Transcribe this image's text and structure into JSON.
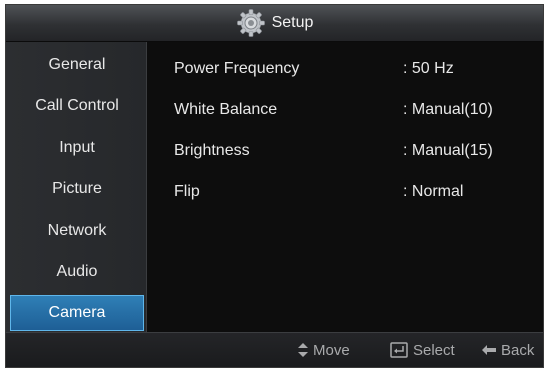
{
  "header": {
    "title": "Setup",
    "icon": "gear-icon"
  },
  "sidebar": {
    "items": [
      {
        "label": "General"
      },
      {
        "label": "Call Control"
      },
      {
        "label": "Input"
      },
      {
        "label": "Picture"
      },
      {
        "label": "Network"
      },
      {
        "label": "Audio"
      },
      {
        "label": "Camera",
        "selected": true
      }
    ]
  },
  "settings": [
    {
      "label": "Power Frequency",
      "value": ": 50 Hz"
    },
    {
      "label": "White Balance",
      "value": ": Manual(10)"
    },
    {
      "label": "Brightness",
      "value": ": Manual(15)"
    },
    {
      "label": "Flip",
      "value": ": Normal"
    }
  ],
  "footer": {
    "move": {
      "label": "Move",
      "icon": "up-down-arrows-icon"
    },
    "select": {
      "label": "Select",
      "icon": "enter-key-icon"
    },
    "back": {
      "label": "Back",
      "icon": "left-arrow-icon"
    }
  },
  "colors": {
    "selected_bg": "#2479b0",
    "selected_border": "#5fb6ea",
    "background": "#141414"
  }
}
